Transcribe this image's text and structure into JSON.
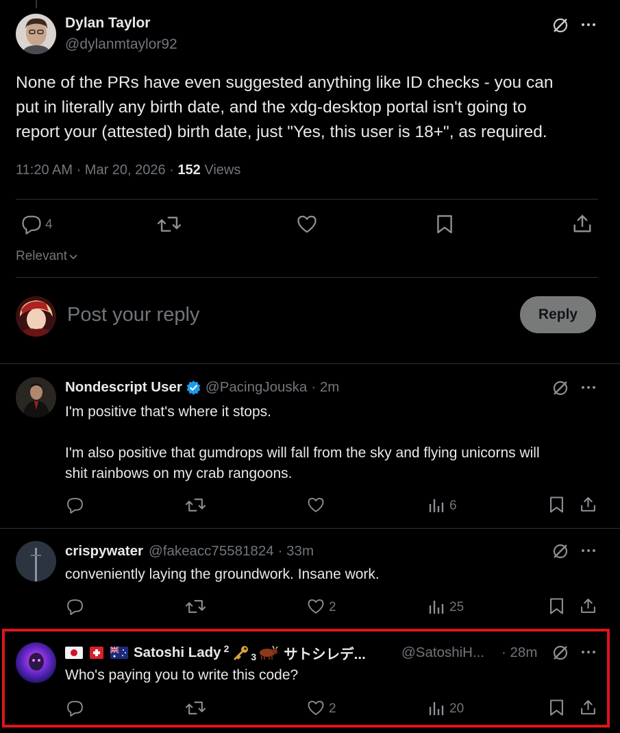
{
  "main_post": {
    "author_name": "Dylan Taylor",
    "author_handle": "@dylanmtaylor92",
    "text_lines": [
      "None of the PRs have even suggested anything like ID checks - you can",
      "put in literally any birth date, and the xdg-desktop portal isn't going to",
      "report your (attested) birth date, just \"Yes, this user is 18+\", as required."
    ],
    "time": "11:20 AM · Mar 20, 2026 · ",
    "views_count": "152",
    "views_label": " Views",
    "reply_count": "4",
    "sort_label": "Relevant"
  },
  "composer": {
    "placeholder": "Post your reply",
    "reply_label": "Reply"
  },
  "replies": [
    {
      "name": "Nondescript User",
      "verified": true,
      "handle": "@PacingJouska",
      "time": "· 2m",
      "lines": [
        "I'm positive that's where it stops.",
        "",
        "I'm also positive that gumdrops will fall from the sky and flying unicorns will",
        "shit rainbows on my crab rangoons."
      ],
      "likes": "",
      "views": "6"
    },
    {
      "name": "crispywater",
      "verified": false,
      "handle": "@fakeacc75581824",
      "time": "· 33m",
      "lines": [
        "conveniently laying the groundwork. Insane work."
      ],
      "likes": "2",
      "views": "25"
    },
    {
      "name_flags": "🇯🇵 🇨🇭 🇦🇺",
      "name": "Satoshi Lady",
      "name_sup": "2",
      "name_key": "🔑",
      "name_sub": "3",
      "name_ox": "🐂",
      "name_jp": "サトシレデ...",
      "handle": "@SatoshiH...",
      "time": "· 28m",
      "lines": [
        "Who's paying you to write this code?"
      ],
      "likes": "2",
      "views": "20"
    }
  ],
  "colors": {
    "background": "#000000",
    "text": "#e7e9ea",
    "muted": "#71767b",
    "verified": "#1d9bf0",
    "highlight": "#e0151b",
    "reply_button": "#787a7a"
  }
}
